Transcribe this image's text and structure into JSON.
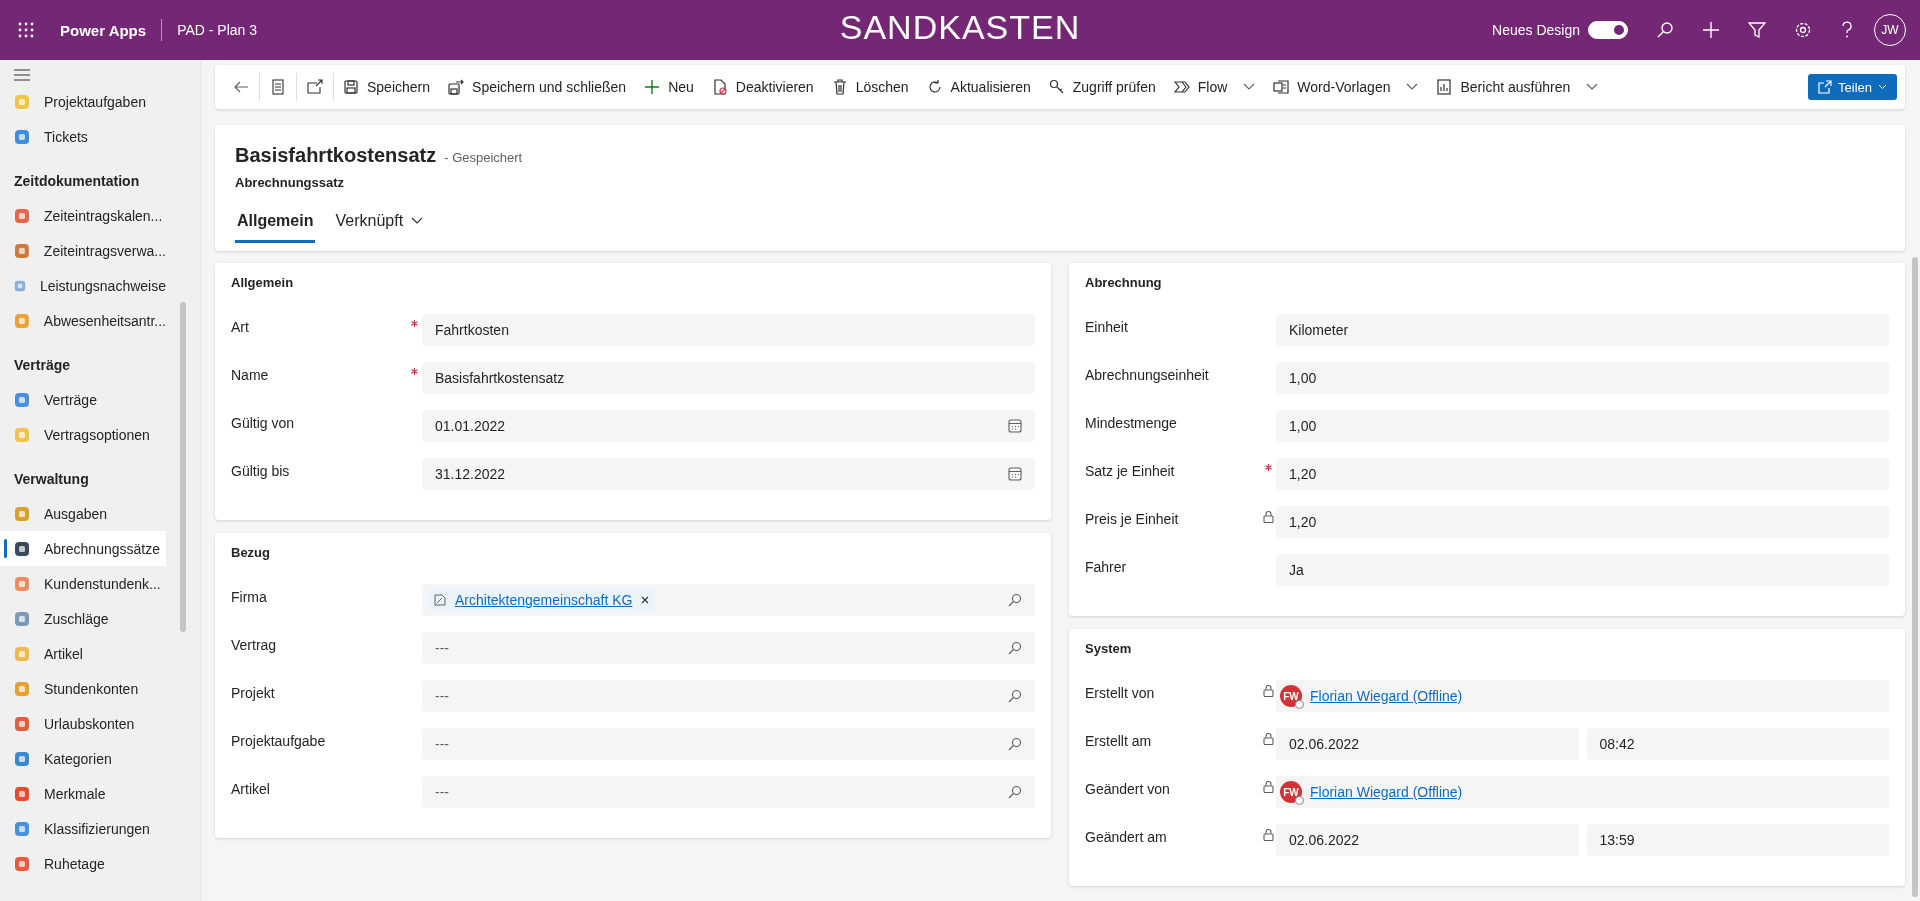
{
  "top_bar": {
    "app_name": "Power Apps",
    "environment": "PAD - Plan 3",
    "banner": "SANDKASTEN",
    "design_toggle": {
      "label": "Neues Design",
      "on": true
    },
    "avatar": "JW"
  },
  "sidebar": {
    "groups": [
      {
        "items": [
          {
            "label": "Projektaufgaben",
            "selected": false
          },
          {
            "label": "Tickets",
            "selected": false
          }
        ]
      },
      {
        "header": "Zeitdokumentation",
        "items": [
          {
            "label": "Zeiteintragskalen...",
            "selected": false
          },
          {
            "label": "Zeiteintragsverwa...",
            "selected": false
          },
          {
            "label": "Leistungsnachweise",
            "selected": false
          },
          {
            "label": "Abwesenheitsantr...",
            "selected": false
          }
        ]
      },
      {
        "header": "Verträge",
        "items": [
          {
            "label": "Verträge",
            "selected": false
          },
          {
            "label": "Vertragsoptionen",
            "selected": false
          }
        ]
      },
      {
        "header": "Verwaltung",
        "items": [
          {
            "label": "Ausgaben",
            "selected": false
          },
          {
            "label": "Abrechnungssätze",
            "selected": true
          },
          {
            "label": "Kundenstundenk...",
            "selected": false
          },
          {
            "label": "Zuschläge",
            "selected": false
          },
          {
            "label": "Artikel",
            "selected": false
          },
          {
            "label": "Stundenkonten",
            "selected": false
          },
          {
            "label": "Urlaubskonten",
            "selected": false
          },
          {
            "label": "Kategorien",
            "selected": false
          },
          {
            "label": "Merkmale",
            "selected": false
          },
          {
            "label": "Klassifizierungen",
            "selected": false
          },
          {
            "label": "Ruhetage",
            "selected": false
          }
        ]
      }
    ]
  },
  "command_bar": {
    "buttons": [
      {
        "label": "Speichern",
        "dropdown": false
      },
      {
        "label": "Speichern und schließen",
        "dropdown": false
      },
      {
        "label": "Neu",
        "dropdown": false
      },
      {
        "label": "Deaktivieren",
        "dropdown": false
      },
      {
        "label": "Löschen",
        "dropdown": false
      },
      {
        "label": "Aktualisieren",
        "dropdown": false
      },
      {
        "label": "Zugriff prüfen",
        "dropdown": false
      },
      {
        "label": "Flow",
        "dropdown": true
      },
      {
        "label": "Word-Vorlagen",
        "dropdown": true
      },
      {
        "label": "Bericht ausführen",
        "dropdown": true
      }
    ],
    "share": "Teilen"
  },
  "record": {
    "title": "Basisfahrtkostensatz",
    "status": "- Gespeichert",
    "entity": "Abrechnungssatz",
    "tabs": [
      {
        "label": "Allgemein",
        "selected": true,
        "dropdown": false
      },
      {
        "label": "Verknüpft",
        "selected": false,
        "dropdown": true
      }
    ]
  },
  "columns": [
    [
      {
        "title": "Allgemein",
        "fields": [
          {
            "label": "Art",
            "required": true,
            "locked": false,
            "kind": "text",
            "value": "Fahrtkosten"
          },
          {
            "label": "Name",
            "required": true,
            "locked": false,
            "kind": "text",
            "value": "Basisfahrtkostensatz"
          },
          {
            "label": "Gültig von",
            "required": false,
            "locked": false,
            "kind": "date",
            "value": "01.01.2022"
          },
          {
            "label": "Gültig bis",
            "required": false,
            "locked": false,
            "kind": "date",
            "value": "31.12.2022"
          }
        ]
      },
      {
        "title": "Bezug",
        "fields": [
          {
            "label": "Firma",
            "required": false,
            "locked": false,
            "kind": "tag",
            "value": "Architektengemeinschaft KG"
          },
          {
            "label": "Vertrag",
            "required": false,
            "locked": false,
            "kind": "lookup",
            "value": "---"
          },
          {
            "label": "Projekt",
            "required": false,
            "locked": false,
            "kind": "lookup",
            "value": "---"
          },
          {
            "label": "Projektaufgabe",
            "required": false,
            "locked": false,
            "kind": "lookup",
            "value": "---"
          },
          {
            "label": "Artikel",
            "required": false,
            "locked": false,
            "kind": "lookup",
            "value": "---"
          }
        ]
      }
    ],
    [
      {
        "title": "Abrechnung",
        "fields": [
          {
            "label": "Einheit",
            "required": false,
            "locked": false,
            "kind": "text",
            "value": "Kilometer"
          },
          {
            "label": "Abrechnungseinheit",
            "required": false,
            "locked": false,
            "kind": "text",
            "value": "1,00"
          },
          {
            "label": "Mindestmenge",
            "required": false,
            "locked": false,
            "kind": "text",
            "value": "1,00"
          },
          {
            "label": "Satz je Einheit",
            "required": true,
            "locked": false,
            "kind": "text",
            "value": "1,20"
          },
          {
            "label": "Preis je Einheit",
            "required": false,
            "locked": true,
            "kind": "text",
            "value": "1,20"
          },
          {
            "label": "Fahrer",
            "required": false,
            "locked": false,
            "kind": "text",
            "value": "Ja"
          }
        ]
      },
      {
        "title": "System",
        "fields": [
          {
            "label": "Erstellt von",
            "required": false,
            "locked": true,
            "kind": "user",
            "initials": "FW",
            "value": "Florian Wiegard (Offline)"
          },
          {
            "label": "Erstellt am",
            "required": false,
            "locked": true,
            "kind": "datetime",
            "value": "02.06.2022",
            "time": "08:42"
          },
          {
            "label": "Geändert von",
            "required": false,
            "locked": true,
            "kind": "user",
            "initials": "FW",
            "value": "Florian Wiegard (Offline)"
          },
          {
            "label": "Geändert am",
            "required": false,
            "locked": true,
            "kind": "datetime",
            "value": "02.06.2022",
            "time": "13:59"
          }
        ]
      }
    ]
  ]
}
